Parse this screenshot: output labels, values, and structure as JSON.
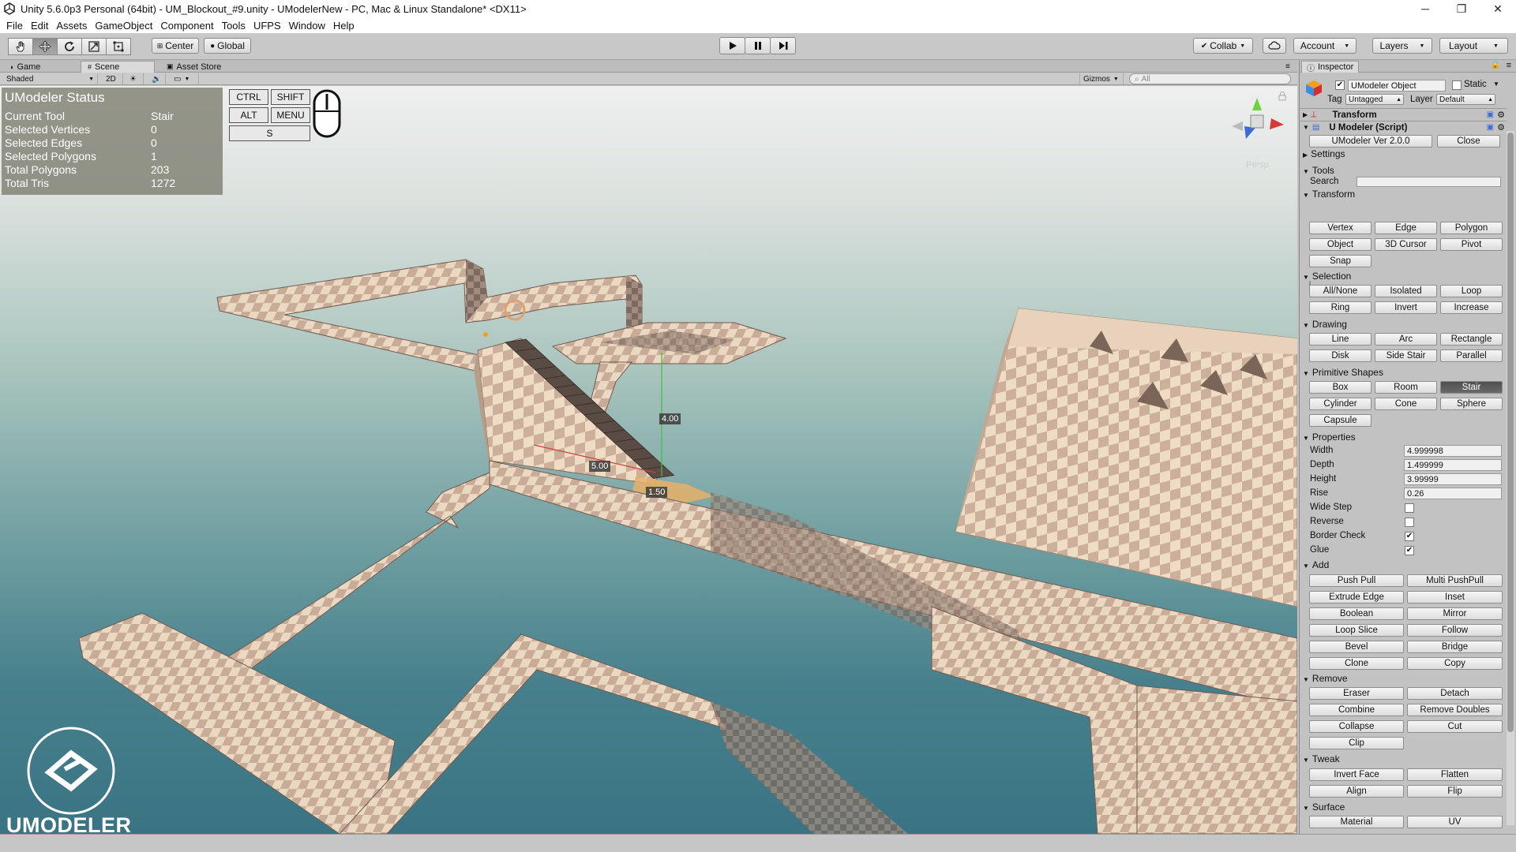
{
  "window": {
    "title": "Unity 5.6.0p3 Personal (64bit) - UM_Blockout_#9.unity - UModelerNew - PC, Mac & Linux Standalone* <DX11>",
    "minimize": "─",
    "maximize": "❐",
    "close": "✕"
  },
  "menu": [
    "File",
    "Edit",
    "Assets",
    "GameObject",
    "Component",
    "Tools",
    "UFPS",
    "Window",
    "Help"
  ],
  "toolbar": {
    "center": "Center",
    "global": "Global",
    "collab": "Collab",
    "account": "Account",
    "layers": "Layers",
    "layout": "Layout"
  },
  "tabs": {
    "game": "Game",
    "scene": "Scene",
    "asset_store": "Asset Store"
  },
  "scenebar": {
    "shaded": "Shaded",
    "mode2d": "2D",
    "gizmos": "Gizmos",
    "search_placeholder": "All"
  },
  "status": {
    "title": "UModeler Status",
    "rows": [
      {
        "label": "Current Tool",
        "value": "Stair"
      },
      {
        "label": "Selected Vertices",
        "value": "0"
      },
      {
        "label": "Selected Edges",
        "value": "0"
      },
      {
        "label": "Selected Polygons",
        "value": "1"
      },
      {
        "label": "Total Polygons",
        "value": "203"
      },
      {
        "label": "Total Tris",
        "value": "1272"
      }
    ]
  },
  "keys": {
    "ctrl": "CTRL",
    "shift": "SHIFT",
    "alt": "ALT",
    "menu": "MENU",
    "s": "S"
  },
  "measures": {
    "height": "4.00",
    "width": "5.00",
    "depth": "1.50"
  },
  "gizmo_label": "Persp",
  "brand": "UMODELER",
  "inspector": {
    "tab": "Inspector",
    "object_name": "UModeler Object",
    "static_label": "Static",
    "tag_label": "Tag",
    "tag_value": "Untagged",
    "layer_label": "Layer",
    "layer_value": "Default",
    "transform": "Transform",
    "script": "U Modeler (Script)",
    "version_button": "UModeler Ver 2.0.0",
    "close_button": "Close",
    "settings": "Settings",
    "tools": "Tools",
    "search_label": "Search",
    "sections": {
      "transform": {
        "title": "Transform",
        "buttons": [
          "Vertex",
          "Edge",
          "Polygon",
          "Object",
          "3D Cursor",
          "Pivot",
          "Snap"
        ]
      },
      "selection": {
        "title": "Selection",
        "buttons": [
          "All/None",
          "Isolated",
          "Loop",
          "Ring",
          "Invert",
          "Increase"
        ]
      },
      "drawing": {
        "title": "Drawing",
        "buttons": [
          "Line",
          "Arc",
          "Rectangle",
          "Disk",
          "Side Stair",
          "Parallel"
        ]
      },
      "primitive": {
        "title": "Primitive Shapes",
        "buttons": [
          "Box",
          "Room",
          "Stair",
          "Cylinder",
          "Cone",
          "Sphere",
          "Capsule"
        ]
      },
      "properties": {
        "title": "Properties",
        "fields": [
          {
            "label": "Width",
            "value": "4.999998"
          },
          {
            "label": "Depth",
            "value": "1.499999"
          },
          {
            "label": "Height",
            "value": "3.99999"
          },
          {
            "label": "Rise",
            "value": "0.26"
          }
        ],
        "checks": [
          {
            "label": "Wide Step",
            "checked": false
          },
          {
            "label": "Reverse",
            "checked": false
          },
          {
            "label": "Border Check",
            "checked": true
          },
          {
            "label": "Glue",
            "checked": true
          }
        ]
      },
      "add": {
        "title": "Add",
        "buttons": [
          "Push Pull",
          "Multi PushPull",
          "Extrude Edge",
          "Inset",
          "Boolean",
          "Mirror",
          "Loop Slice",
          "Follow",
          "Bevel",
          "Bridge",
          "Clone",
          "Copy"
        ]
      },
      "remove": {
        "title": "Remove",
        "buttons": [
          "Eraser",
          "Detach",
          "Combine",
          "Remove Doubles",
          "Collapse",
          "Cut",
          "Clip"
        ]
      },
      "tweak": {
        "title": "Tweak",
        "buttons": [
          "Invert Face",
          "Flatten",
          "Align",
          "Flip"
        ]
      },
      "surface": {
        "title": "Surface",
        "buttons": [
          "Material",
          "UV"
        ]
      }
    }
  }
}
